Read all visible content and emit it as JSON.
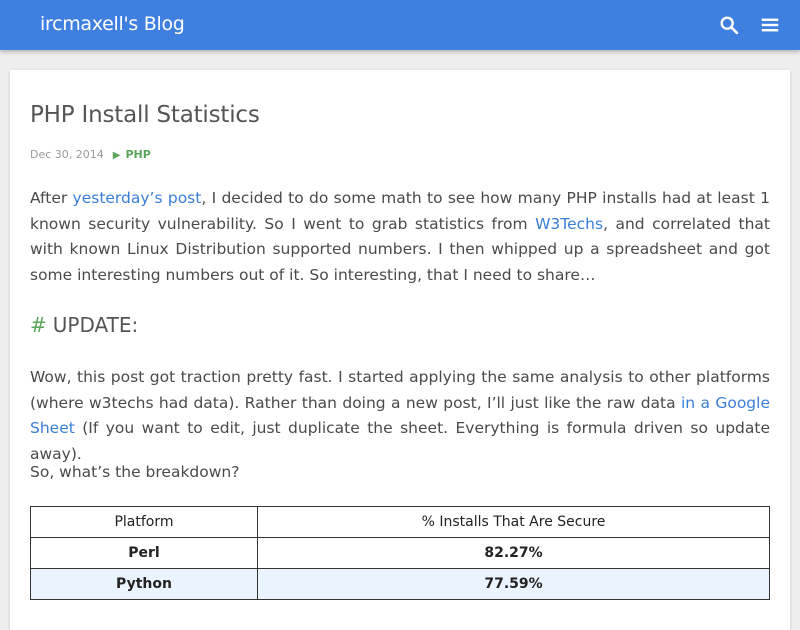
{
  "header": {
    "brand": "ircmaxell's Blog",
    "search_icon": "search-icon",
    "menu_icon": "hamburger-menu-icon",
    "bar_color": "#3e7fe0"
  },
  "post": {
    "title": "PHP Install Statistics",
    "date": "Dec 30, 2014",
    "category": "PHP",
    "intro": {
      "before_link1": "After ",
      "link1": "yesterday’s post",
      "after_link1": ", I decided to do some math to see how many PHP installs had at least 1 known security vulnerability. So I went to grab statistics from ",
      "link2": "W3Techs",
      "after_link2": ", and correlated that with known Linux Distribution supported numbers. I then whipped up a spreadsheet and got some interesting numbers out of it. So interesting, that I need to share…"
    },
    "update_heading": "UPDATE:",
    "update_body": {
      "before_link": "Wow, this post got traction pretty fast. I started applying the same analysis to other platforms (where w3techs had data). Rather than doing a new post, I’ll just like the raw data ",
      "link": "in a Google Sheet",
      "after_link": " (If you want to edit, just duplicate the sheet. Everything is formula driven so update away)."
    },
    "breakdown_question": "So, what’s the breakdown?",
    "table": {
      "headers": [
        "Platform",
        "% Installs That Are Secure"
      ],
      "rows": [
        [
          "Perl",
          "82.27%"
        ],
        [
          "Python",
          "77.59%"
        ]
      ]
    }
  },
  "colors": {
    "link": "#3a7ed8",
    "accent_green": "#5aa55a",
    "alt_row": "#eaf4ff"
  }
}
